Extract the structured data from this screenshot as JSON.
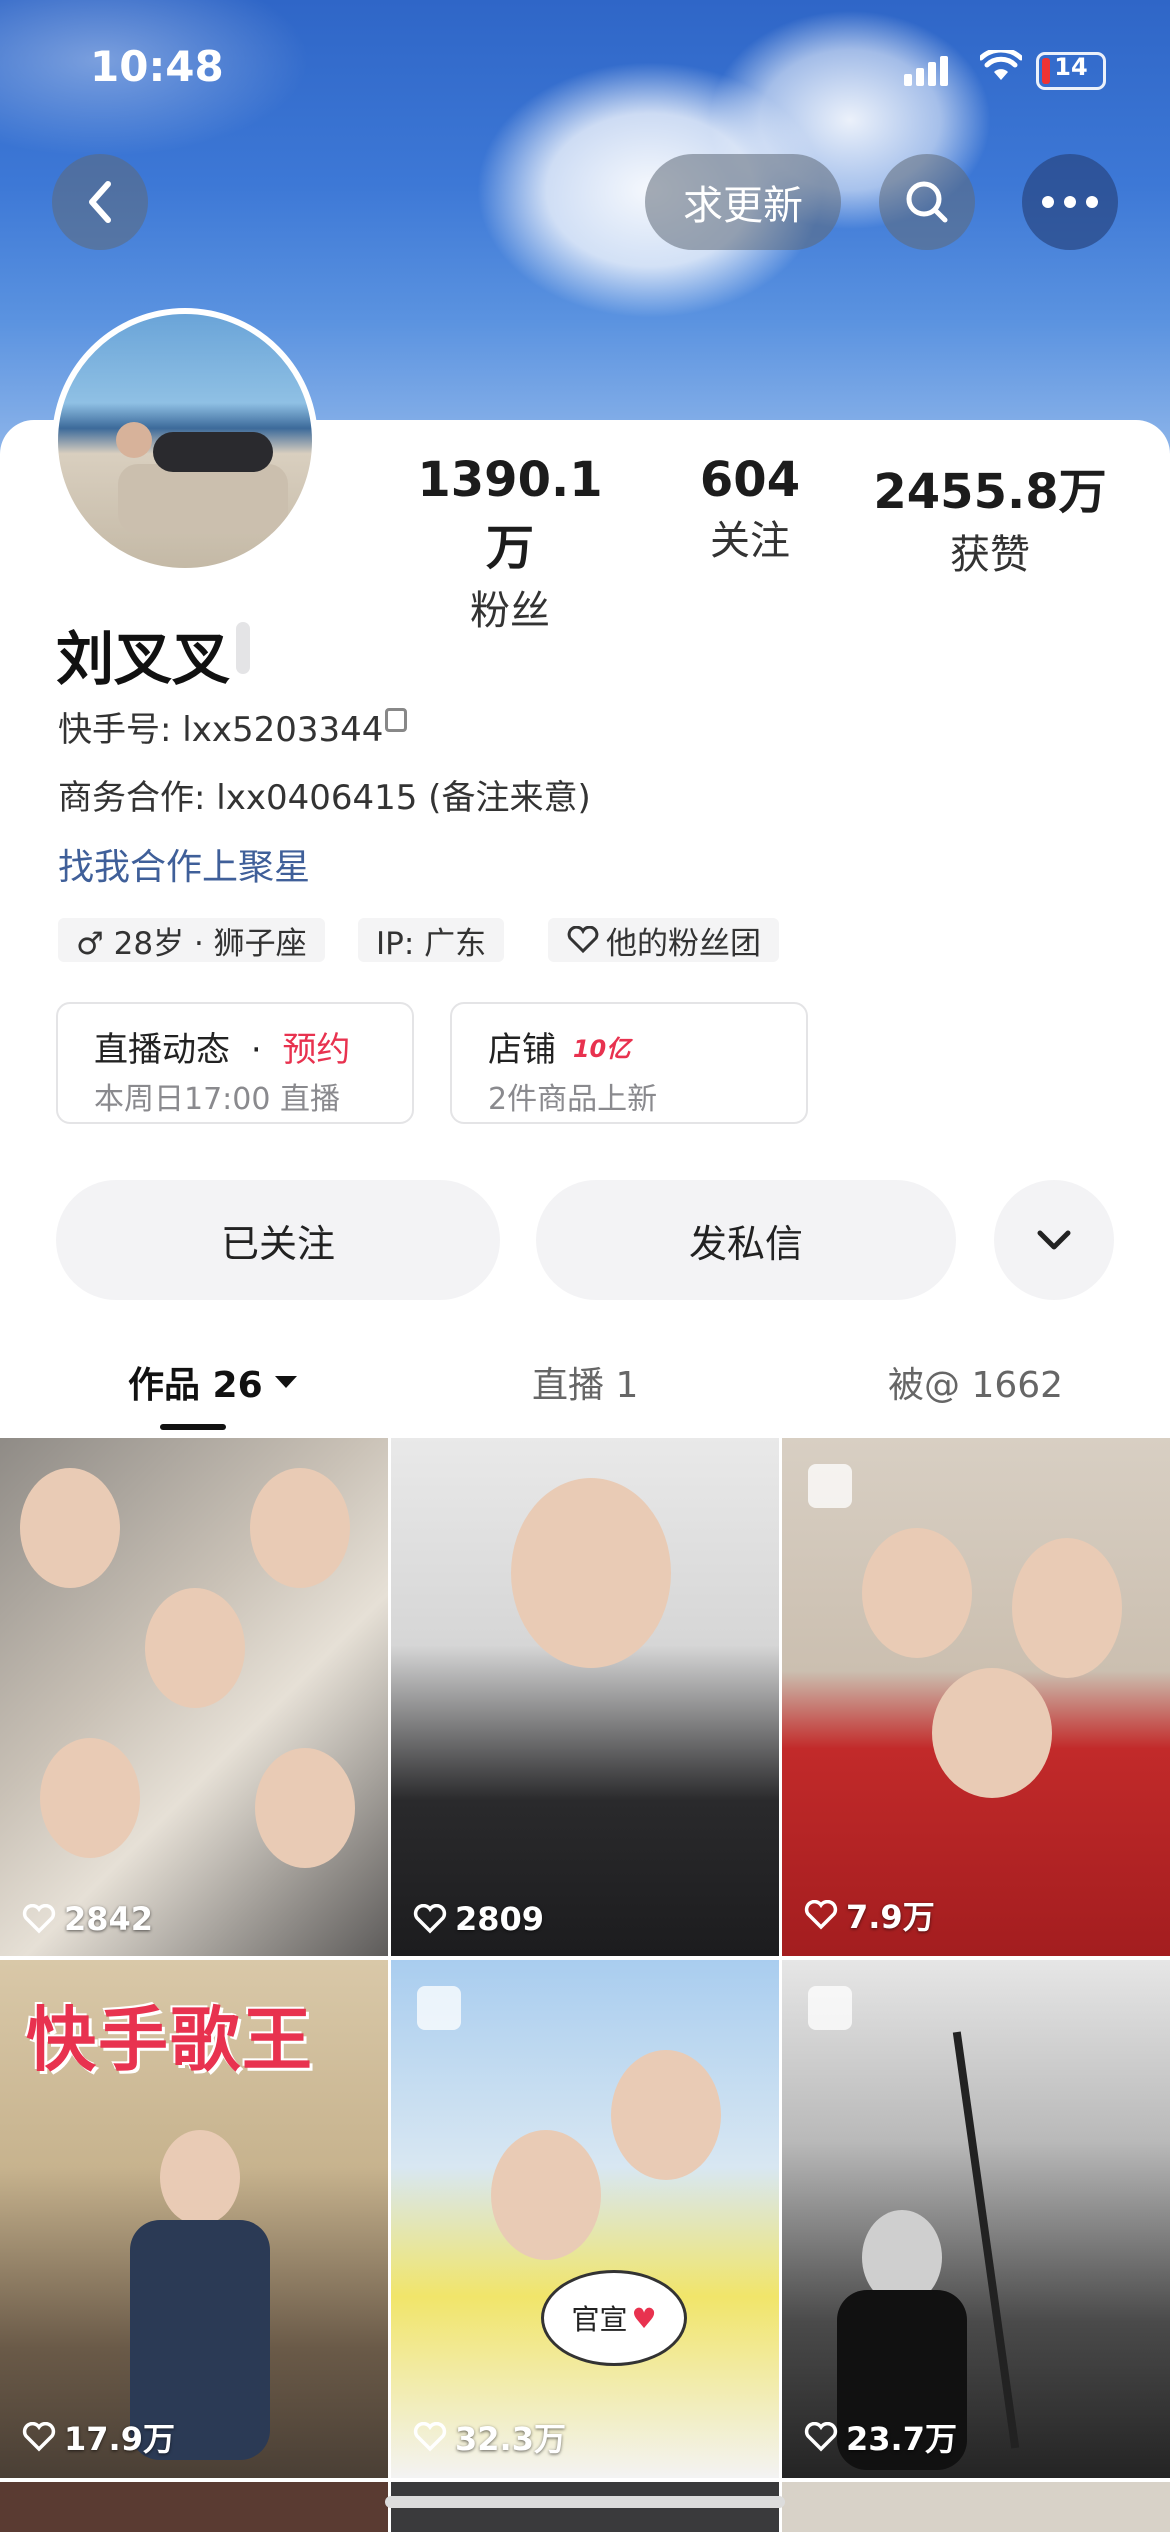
{
  "status_bar": {
    "time": "10:48",
    "battery": "14"
  },
  "header": {
    "update_button": "求更新"
  },
  "stats": [
    {
      "value": "1390.1万",
      "label": "粉丝"
    },
    {
      "value": "604",
      "label": "关注"
    },
    {
      "value": "2455.8万",
      "label": "获赞"
    }
  ],
  "profile": {
    "name": "刘叉叉",
    "id_line": "快手号: lxx5203344",
    "business_line": "商务合作: lxx0406415 (备注来意)",
    "link": "找我合作上聚星",
    "tags": [
      "♂ 28岁 · 狮子座",
      "IP: 广东",
      "他的粉丝团"
    ]
  },
  "cards": {
    "live": {
      "title": "直播动态",
      "separator": "·",
      "highlight": "预约",
      "subtitle": "本周日17:00 直播"
    },
    "shop": {
      "title": "店铺",
      "badge": "10亿",
      "subtitle": "2件商品上新"
    }
  },
  "buttons": {
    "follow": "已关注",
    "message": "发私信"
  },
  "tabs": [
    {
      "label": "作品 26"
    },
    {
      "label": "直播 1"
    },
    {
      "label": "被@ 1662"
    }
  ],
  "grid": [
    {
      "likes": "2842"
    },
    {
      "likes": "2809"
    },
    {
      "likes": "7.9万"
    },
    {
      "likes": "17.9万",
      "overlay": "快手歌王"
    },
    {
      "likes": "32.3万",
      "sticker": "官宣"
    },
    {
      "likes": "23.7万"
    }
  ],
  "colors": {
    "accent_red": "#e8324f",
    "link_blue": "#3f5f99",
    "banner_blue": "#3d78d6"
  }
}
